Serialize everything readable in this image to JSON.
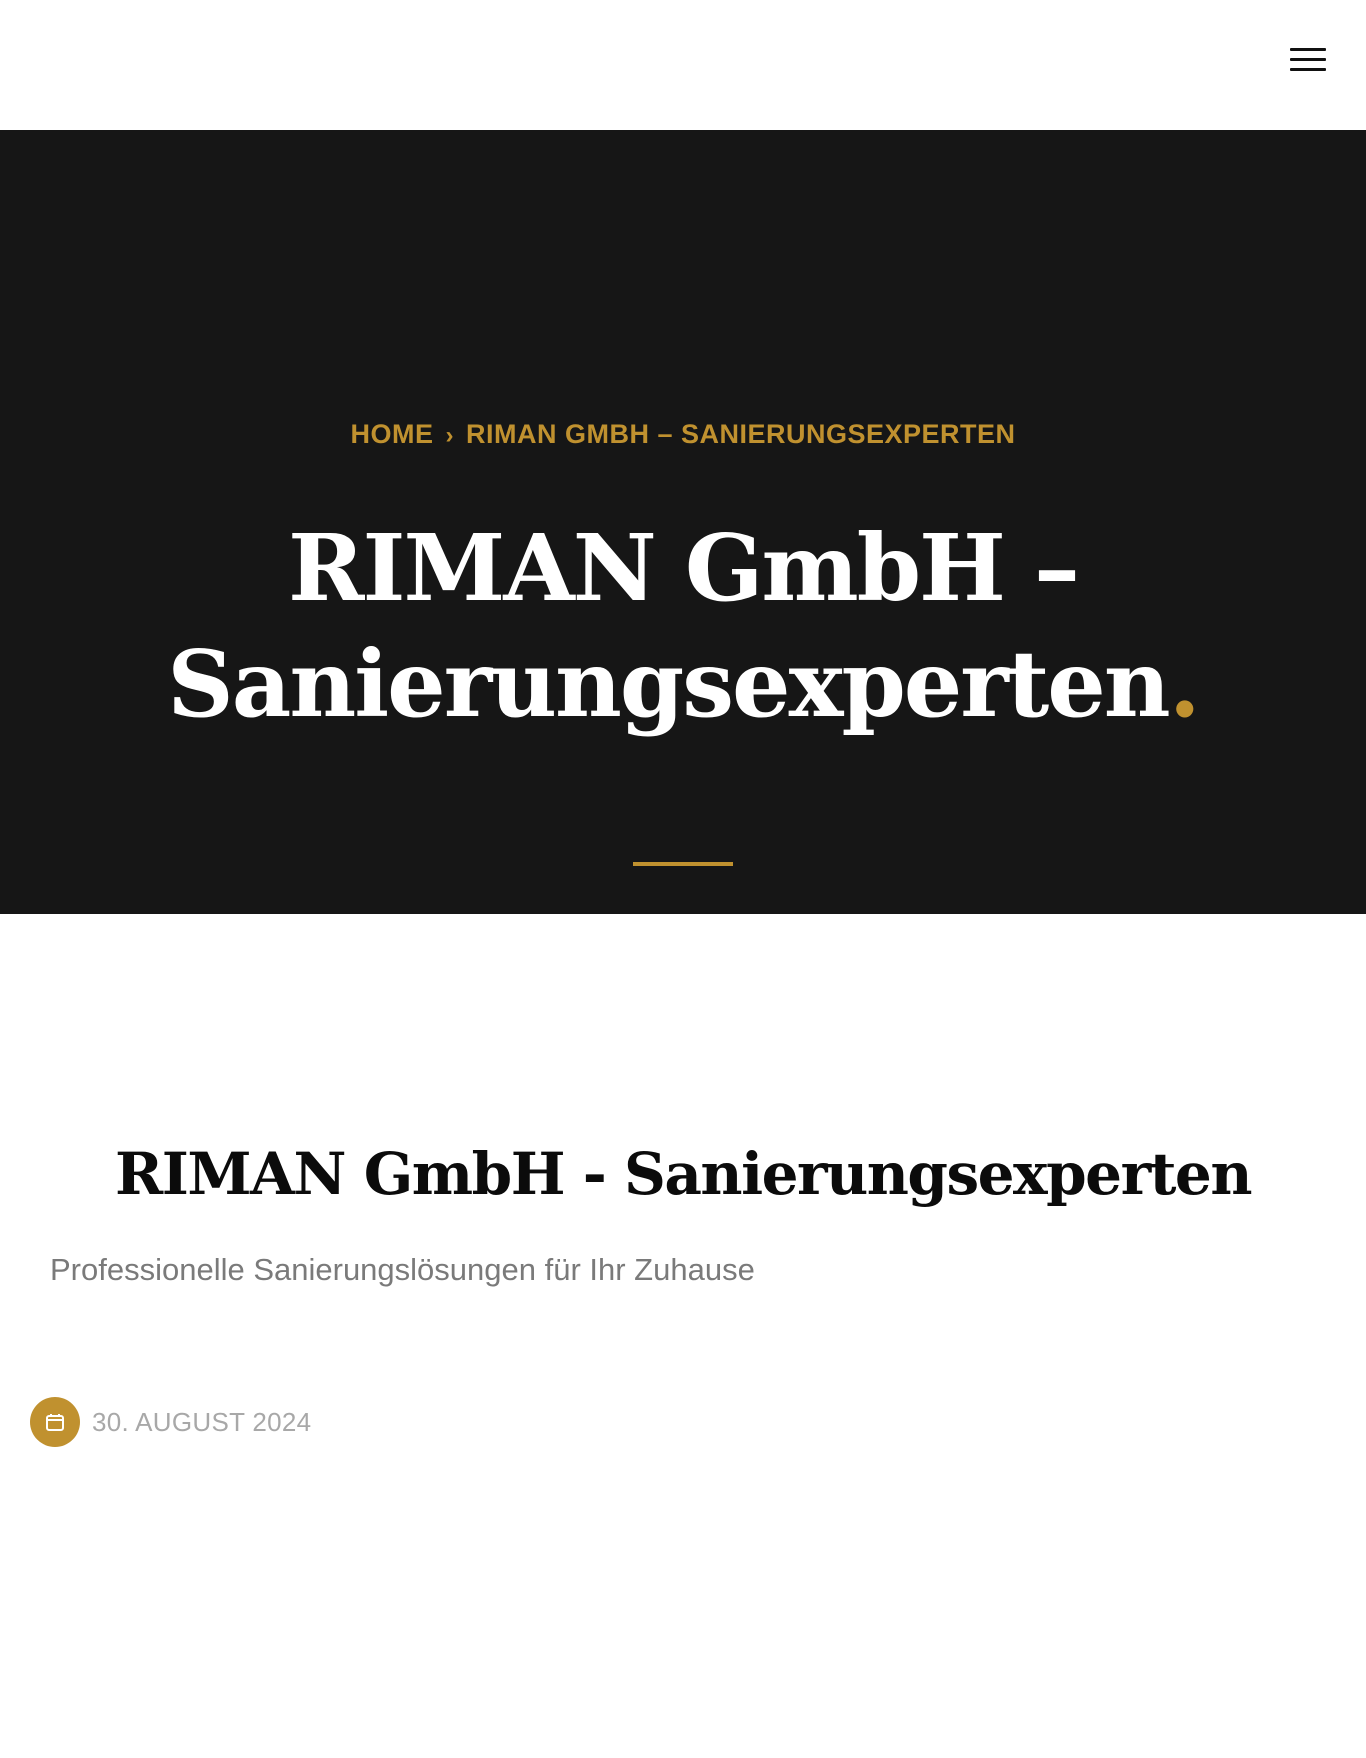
{
  "header": {
    "menu_icon": "hamburger-menu-icon"
  },
  "hero": {
    "breadcrumb": {
      "home": "HOME",
      "separator": "›",
      "current": "RIMAN GMBH – SANIERUNGSEXPERTEN"
    },
    "title_line1": "RIMAN GmbH –",
    "title_line2": "Sanierungsexperten",
    "title_dot": ".",
    "accent_color": "#c0912f",
    "background_color": "#161616"
  },
  "post": {
    "title": "RIMAN GmbH - Sanierungsexperten",
    "subtitle": "Professionelle Sanierungslösungen für Ihr Zuhause",
    "date": "30. AUGUST 2024",
    "date_icon": "calendar-icon"
  }
}
